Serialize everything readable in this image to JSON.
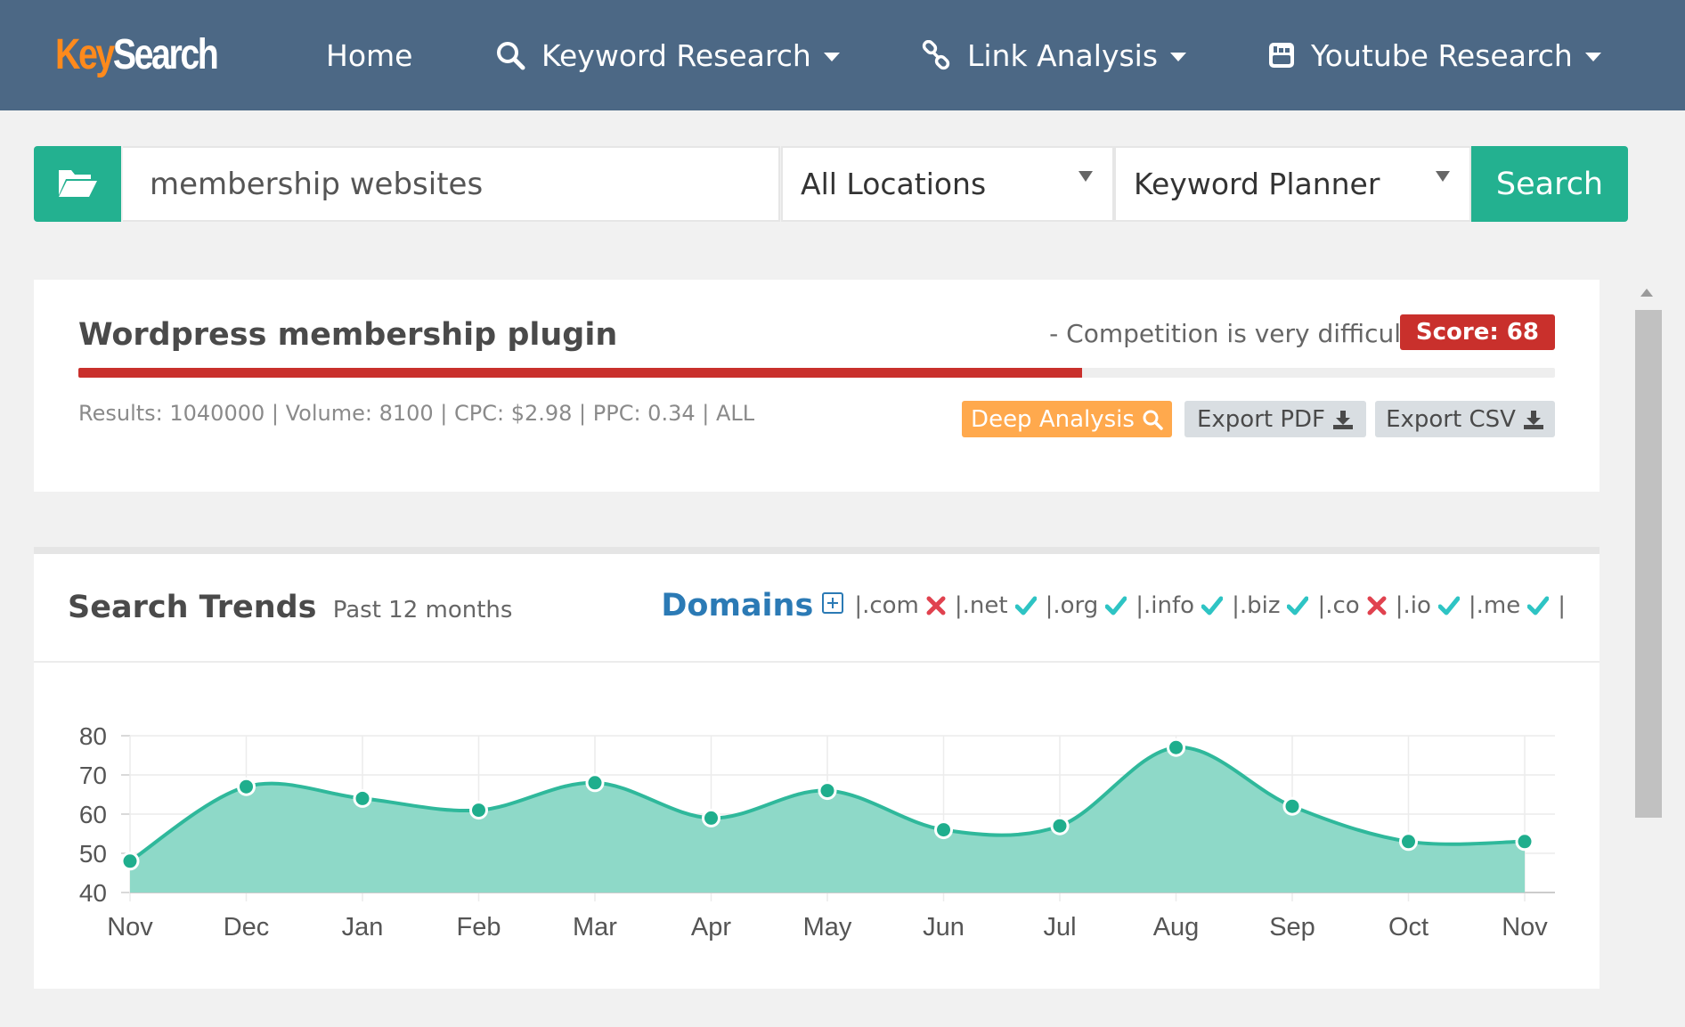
{
  "nav": {
    "logo_part1": "Key",
    "logo_part2": "Search",
    "items": [
      {
        "label": "Home",
        "icon": "none"
      },
      {
        "label": "Keyword Research",
        "icon": "search-icon"
      },
      {
        "label": "Link Analysis",
        "icon": "link-icon"
      },
      {
        "label": "Youtube Research",
        "icon": "youtube-icon"
      }
    ]
  },
  "search": {
    "keyword_value": "membership websites",
    "location": "All Locations",
    "source": "Keyword Planner",
    "button_label": "Search"
  },
  "keyword": {
    "title": "Wordpress membership plugin",
    "competition_text": "- Competition is very difficult",
    "score_label": "Score: 68",
    "difficulty_fraction": 0.68,
    "stats": "Results: 1040000 | Volume: 8100 | CPC: $2.98 | PPC: 0.34 | ALL",
    "deep_analysis_label": "Deep Analysis",
    "export_pdf_label": "Export PDF",
    "export_csv_label": "Export CSV"
  },
  "trends": {
    "title": "Search Trends",
    "subtitle": "Past 12 months",
    "domains_label": "Domains",
    "domains": [
      {
        "label": ".com",
        "available": false
      },
      {
        "label": ".net",
        "available": true
      },
      {
        "label": ".org",
        "available": true
      },
      {
        "label": ".info",
        "available": true
      },
      {
        "label": ".biz",
        "available": true
      },
      {
        "label": ".co",
        "available": false
      },
      {
        "label": ".io",
        "available": true
      },
      {
        "label": ".me",
        "available": true
      }
    ]
  },
  "colors": {
    "nav": "#4c6885",
    "accent_green": "#23b190",
    "danger": "#c9302c",
    "deep_analysis": "#ffa94d",
    "check": "#2ec4c4",
    "cross": "#e0424f",
    "area_fill": "#8ed9c8",
    "area_line": "#2fb89b"
  },
  "chart_data": {
    "type": "area",
    "categories": [
      "Nov",
      "Dec",
      "Jan",
      "Feb",
      "Mar",
      "Apr",
      "May",
      "Jun",
      "Jul",
      "Aug",
      "Sep",
      "Oct",
      "Nov"
    ],
    "values": [
      48,
      67,
      64,
      61,
      68,
      59,
      66,
      56,
      57,
      77,
      62,
      53,
      53
    ],
    "yticks": [
      40,
      50,
      60,
      70,
      80
    ],
    "ylim": [
      40,
      80
    ],
    "grid": true,
    "legend": "none"
  }
}
